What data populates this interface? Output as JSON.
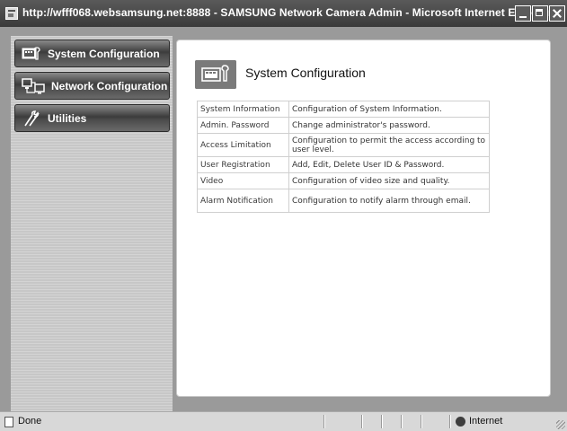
{
  "window": {
    "title": "http://wfff068.websamsung.net:8888 - SAMSUNG Network Camera Admin - Microsoft Internet Explorer"
  },
  "sidebar": {
    "items": [
      {
        "label": "System Configuration",
        "icon": "monitor-wrench-icon"
      },
      {
        "label": "Network Configuration",
        "icon": "network-computers-icon"
      },
      {
        "label": "Utilities",
        "icon": "tools-icon"
      }
    ]
  },
  "main": {
    "title": "System Configuration",
    "title_icon": "monitor-wrench-icon",
    "table": {
      "rows": [
        {
          "name": "System Information",
          "description": "Configuration of System Information."
        },
        {
          "name": "Admin. Password",
          "description": "Change administrator's password."
        },
        {
          "name": "Access Limitation",
          "description": "Configuration to permit the access according to user level."
        },
        {
          "name": "User Registration",
          "description": "Add, Edit, Delete User ID & Password."
        },
        {
          "name": "Video",
          "description": "Configuration of video size and quality."
        },
        {
          "name": "Alarm Notification",
          "description": "Configuration to notify alarm through email."
        }
      ]
    }
  },
  "statusbar": {
    "status": "Done",
    "zone": "Internet"
  }
}
